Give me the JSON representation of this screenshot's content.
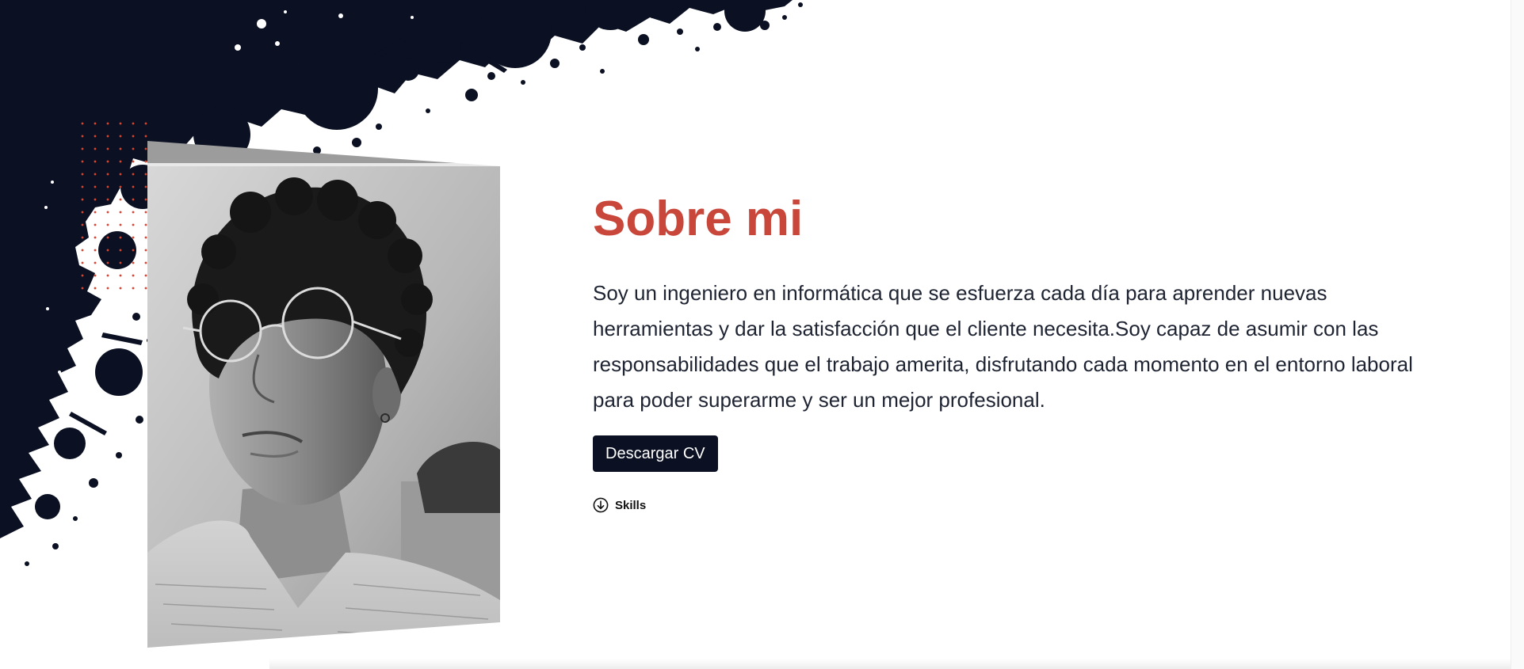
{
  "about": {
    "title": "Sobre mi",
    "description": "Soy un ingeniero en informática que se esfuerza cada día para aprender nuevas herramientas y dar la satisfacción que el cliente necesita.Soy capaz de asumir con las responsabilidades que el trabajo amerita, disfrutando cada momento en el entorno laboral para poder superarme y ser un mejor profesional.",
    "download_button_label": "Descargar CV",
    "skills_link_label": "Skills"
  },
  "colors": {
    "accent": "#c9473a",
    "navy": "#0b1123",
    "text": "#1f2433",
    "dots": "#d9442f"
  },
  "icons": {
    "skills_icon": "arrow-down-circle-icon"
  }
}
